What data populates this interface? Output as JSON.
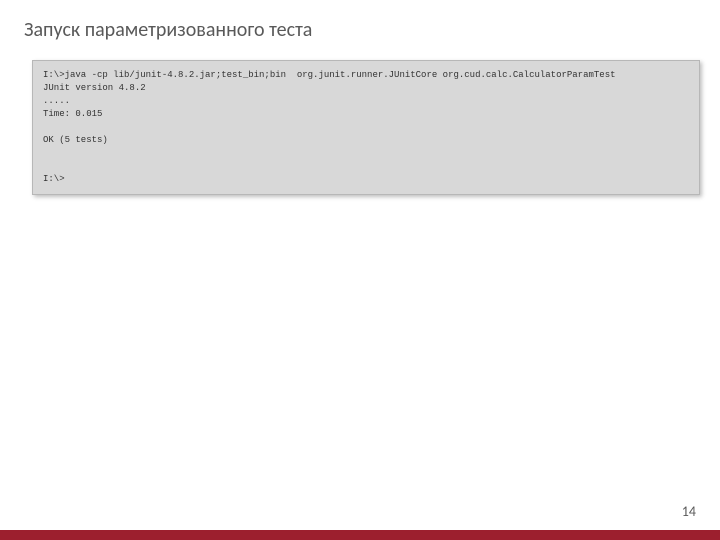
{
  "slide": {
    "title": "Запуск параметризованного теста",
    "page_number": "14"
  },
  "terminal": {
    "output": "I:\\>java -cp lib/junit-4.8.2.jar;test_bin;bin  org.junit.runner.JUnitCore org.cud.calc.CalculatorParamTest\nJUnit version 4.8.2\n.....\nTime: 0.015\n\nOK (5 tests)\n\n\nI:\\>"
  },
  "colors": {
    "accent": "#9c1f2e",
    "terminal_bg": "#d8d8d8"
  }
}
